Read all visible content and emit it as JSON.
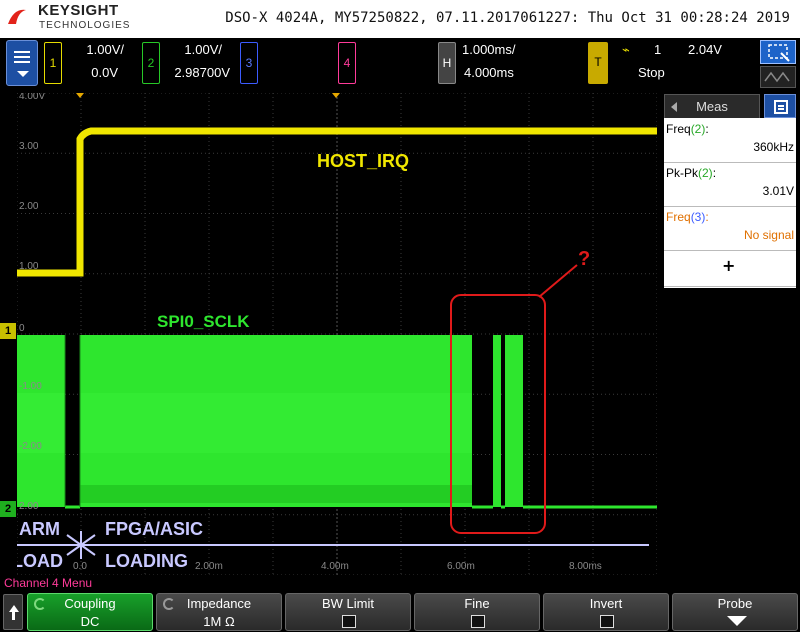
{
  "title_bar": {
    "brand": "KEYSIGHT",
    "brand_sub": "TECHNOLOGIES",
    "scope_info": "DSO-X 4024A, MY57250822, 07.11.2017061227: Thu Oct 31 00:28:24 2019"
  },
  "channels": {
    "ch1": {
      "label": "1",
      "scale": "1.00V/",
      "offset": "0.0V",
      "color": "#e6dc00"
    },
    "ch2": {
      "label": "2",
      "scale": "1.00V/",
      "offset": "2.98700V",
      "color": "#27c827"
    },
    "ch3": {
      "label": "3",
      "color": "#3c5cff"
    },
    "ch4": {
      "label": "4",
      "color": "#ff3b9a"
    }
  },
  "horizontal": {
    "label": "H",
    "scale": "1.000ms/",
    "delay": "4.000ms"
  },
  "trigger": {
    "label": "T",
    "source": "1",
    "level": "2.04V",
    "mode": "Stop",
    "slope_icon": "rising-edge-icon"
  },
  "meas_panel": {
    "tab_label": "Meas",
    "items": [
      {
        "name": "Freq",
        "chan": "(2)",
        "colon": ":",
        "value": "360kHz",
        "color": "#000000"
      },
      {
        "name": "Pk-Pk",
        "chan": "(2)",
        "colon": ":",
        "value": "3.01V",
        "color": "#000000"
      },
      {
        "name": "Freq",
        "chan": "(3)",
        "colon": ":",
        "value": "No signal",
        "color": "#e07000"
      }
    ],
    "add_label": "+"
  },
  "plot": {
    "y_ticks": [
      "4.00V",
      "3.00",
      "2.00",
      "1.00",
      "0",
      "-1.00",
      "-2.00",
      "2.00"
    ],
    "x_ticks": [
      "0.0",
      "2.00m",
      "4.00m",
      "6.00m",
      "8.00ms"
    ],
    "trigger_marker": "T",
    "ch1_marker": "1",
    "ch2_marker": "2",
    "annotations": {
      "host_irq": "HOST_IRQ",
      "spi_sclk": "SPI0_SCLK",
      "question": "?",
      "arm": "ARM",
      "load": "LOAD",
      "fpga": "FPGA/ASIC",
      "loading": "LOADING"
    },
    "colors": {
      "grid": "#3a3a3a",
      "ch1": "#f0e600",
      "ch2": "#2ee62e",
      "annotation_red": "#e01a1a",
      "annotation_text": "#c8c8ff"
    }
  },
  "menu_title": "Channel 4 Menu",
  "softkeys": {
    "coupling": {
      "label": "Coupling",
      "value": "DC"
    },
    "impedance": {
      "label": "Impedance",
      "value": "1M Ω"
    },
    "bw_limit": {
      "label": "BW Limit"
    },
    "fine": {
      "label": "Fine"
    },
    "invert": {
      "label": "Invert"
    },
    "probe": {
      "label": "Probe"
    }
  }
}
